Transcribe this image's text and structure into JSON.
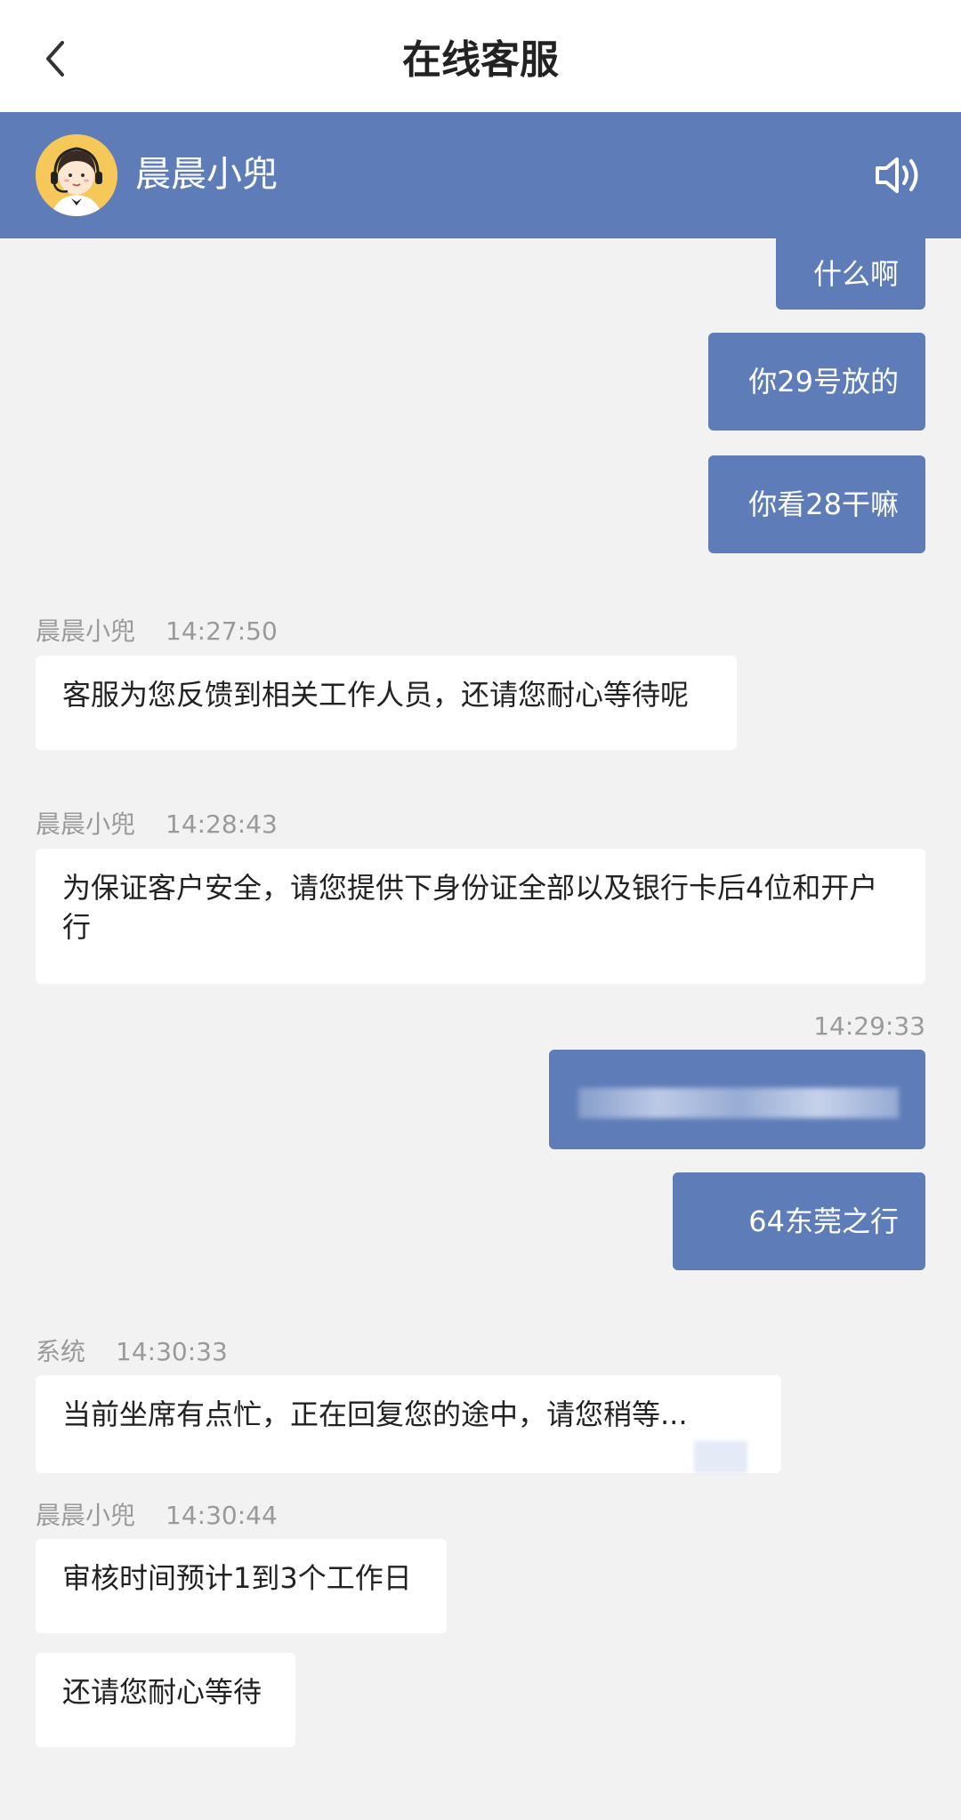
{
  "header": {
    "title": "在线客服",
    "back_icon": "chevron-left-icon"
  },
  "agent": {
    "name": "晨晨小兜",
    "avatar_icon": "agent-headset-avatar",
    "sound_icon": "speaker-icon",
    "bar_color": "#5e7db8"
  },
  "messages": {
    "m1": {
      "text": "什么啊"
    },
    "m2": {
      "text": "你29号放的"
    },
    "m3": {
      "text": "你看28干嘛"
    },
    "m4": {
      "sender": "晨晨小兜",
      "time": "14:27:50",
      "text": "客服为您反馈到相关工作人员，还请您耐心等待呢"
    },
    "m5": {
      "sender": "晨晨小兜",
      "time": "14:28:43",
      "text": "为保证客户安全，请您提供下身份证全部以及银行卡后4位和开户行"
    },
    "m6": {
      "time": "14:29:33",
      "text": ""
    },
    "m7": {
      "text": "64东莞之行"
    },
    "m8": {
      "sender": "系统",
      "time": "14:30:33",
      "text": "当前坐席有点忙，正在回复您的途中，请您稍等..."
    },
    "m9": {
      "sender": "晨晨小兜",
      "time": "14:30:44",
      "text": "审核时间预计1到3个工作日"
    },
    "m10": {
      "text": "还请您耐心等待"
    }
  }
}
